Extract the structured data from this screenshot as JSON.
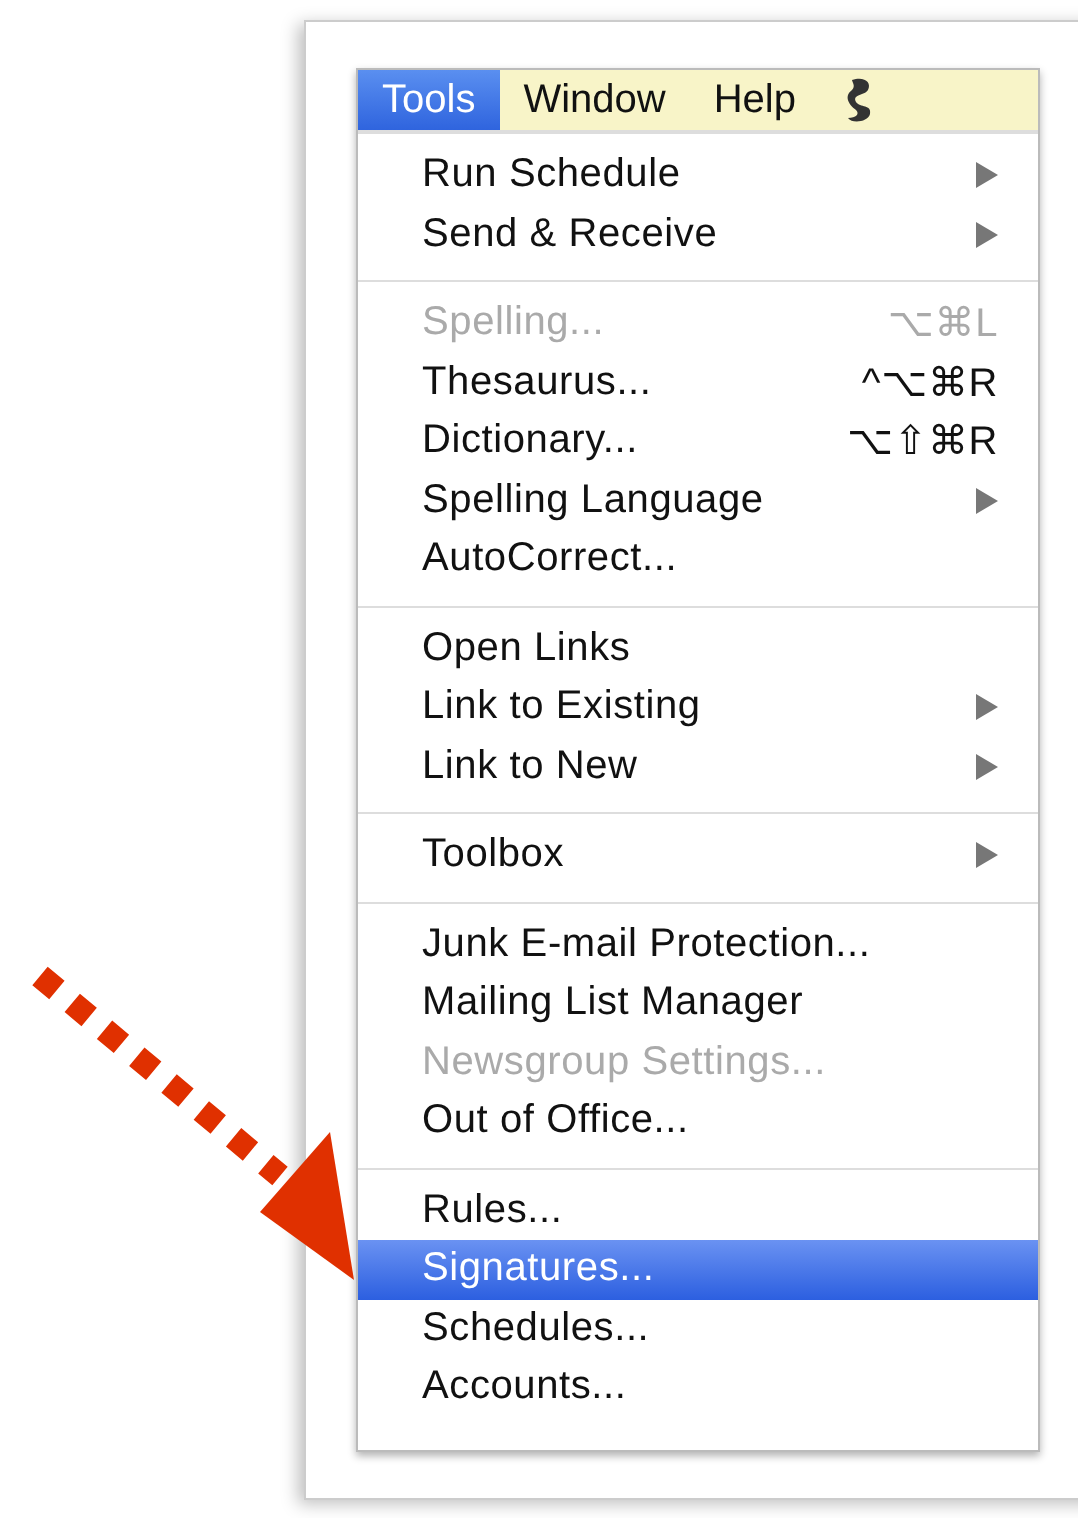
{
  "menu_bar": [
    {
      "label": "Tools",
      "selected": true
    },
    {
      "label": "Window",
      "selected": false
    },
    {
      "label": "Help",
      "selected": false
    }
  ],
  "menu": {
    "groups": [
      {
        "items": [
          {
            "label": "Run Schedule",
            "submenu": true,
            "disabled": false,
            "selected": false
          },
          {
            "label": "Send & Receive",
            "submenu": true,
            "disabled": false,
            "selected": false
          }
        ]
      },
      {
        "items": [
          {
            "label": "Spelling...",
            "shortcut": "⌥⌘L",
            "submenu": false,
            "disabled": true,
            "selected": false
          },
          {
            "label": "Thesaurus...",
            "shortcut": "^⌥⌘R",
            "submenu": false,
            "disabled": false,
            "selected": false
          },
          {
            "label": "Dictionary...",
            "shortcut": "⌥⇧⌘R",
            "submenu": false,
            "disabled": false,
            "selected": false
          },
          {
            "label": "Spelling Language",
            "submenu": true,
            "disabled": false,
            "selected": false
          },
          {
            "label": "AutoCorrect...",
            "submenu": false,
            "disabled": false,
            "selected": false
          }
        ]
      },
      {
        "items": [
          {
            "label": "Open Links",
            "submenu": false,
            "disabled": false,
            "selected": false
          },
          {
            "label": "Link to Existing",
            "submenu": true,
            "disabled": false,
            "selected": false
          },
          {
            "label": "Link to New",
            "submenu": true,
            "disabled": false,
            "selected": false
          }
        ]
      },
      {
        "items": [
          {
            "label": "Toolbox",
            "submenu": true,
            "disabled": false,
            "selected": false
          }
        ]
      },
      {
        "items": [
          {
            "label": "Junk E-mail Protection...",
            "submenu": false,
            "disabled": false,
            "selected": false
          },
          {
            "label": "Mailing List Manager",
            "submenu": false,
            "disabled": false,
            "selected": false
          },
          {
            "label": "Newsgroup Settings...",
            "submenu": false,
            "disabled": true,
            "selected": false
          },
          {
            "label": "Out of Office...",
            "submenu": false,
            "disabled": false,
            "selected": false
          }
        ]
      },
      {
        "items": [
          {
            "label": "Rules...",
            "submenu": false,
            "disabled": false,
            "selected": false
          },
          {
            "label": "Signatures...",
            "submenu": false,
            "disabled": false,
            "selected": true
          },
          {
            "label": "Schedules...",
            "submenu": false,
            "disabled": false,
            "selected": false
          },
          {
            "label": "Accounts...",
            "submenu": false,
            "disabled": false,
            "selected": false
          }
        ]
      }
    ]
  }
}
